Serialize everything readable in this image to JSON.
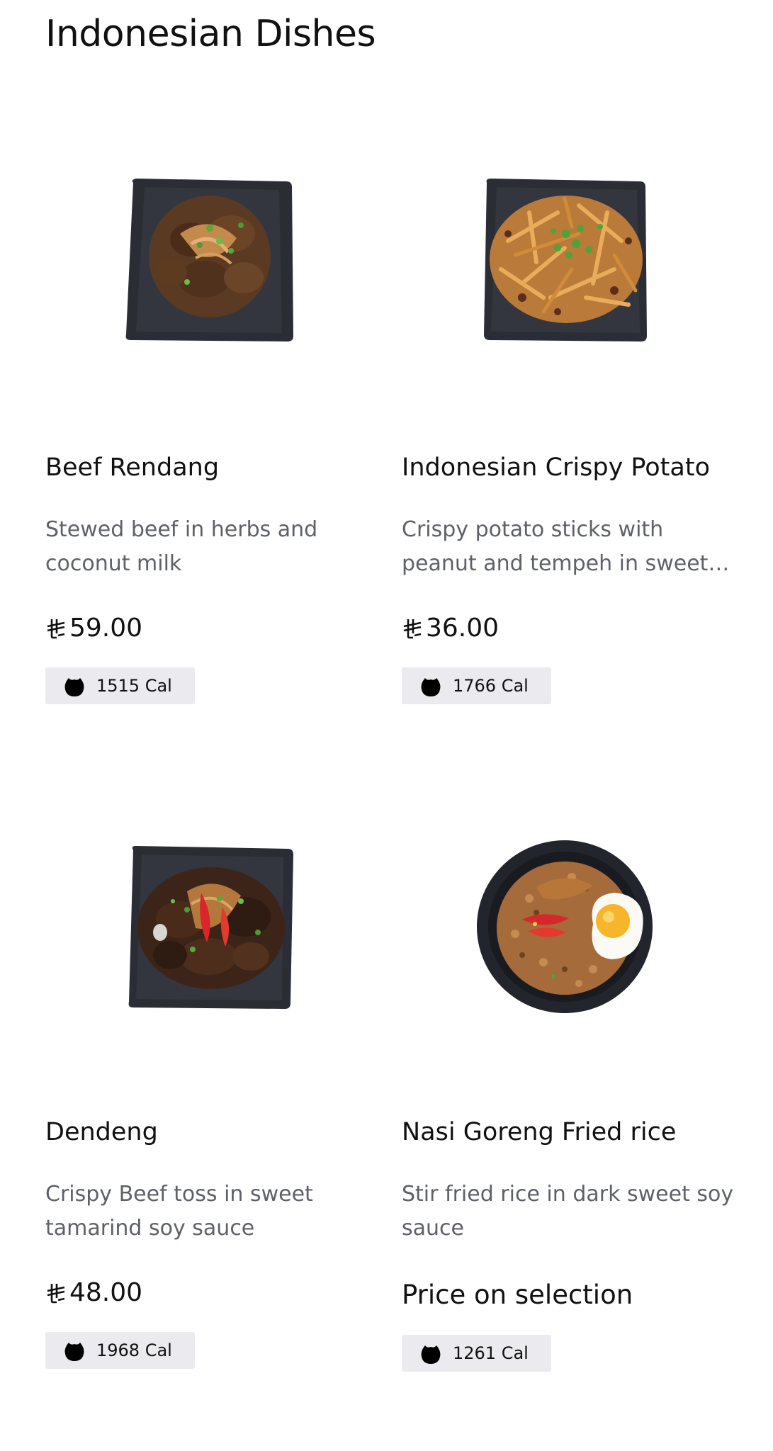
{
  "section": {
    "title": "Indonesian Dishes"
  },
  "colors": {
    "text": "#111111",
    "description": "#5f6169",
    "badge_bg": "#ebebef",
    "plate": "#2b2d35"
  },
  "icons": {
    "currency": "saudi-riyal-icon",
    "calories": "calorie-drop-icon"
  },
  "items": [
    {
      "name": "Beef Rendang",
      "description": "Stewed beef in herbs and coconut milk",
      "price": "59.00",
      "calories": "1515 Cal"
    },
    {
      "name": "Indonesian Crispy Potato",
      "description": "Crispy potato sticks with peanut and tempeh in sweet chili sauce",
      "price": "36.00",
      "calories": "1766 Cal"
    },
    {
      "name": "Dendeng",
      "description": "Crispy Beef toss in sweet tamarind soy sauce",
      "price": "48.00",
      "calories": "1968 Cal"
    },
    {
      "name": "Nasi Goreng Fried rice",
      "description": "Stir fried rice in dark sweet soy sauce",
      "price": "Price on selection",
      "calories": "1261 Cal"
    }
  ]
}
